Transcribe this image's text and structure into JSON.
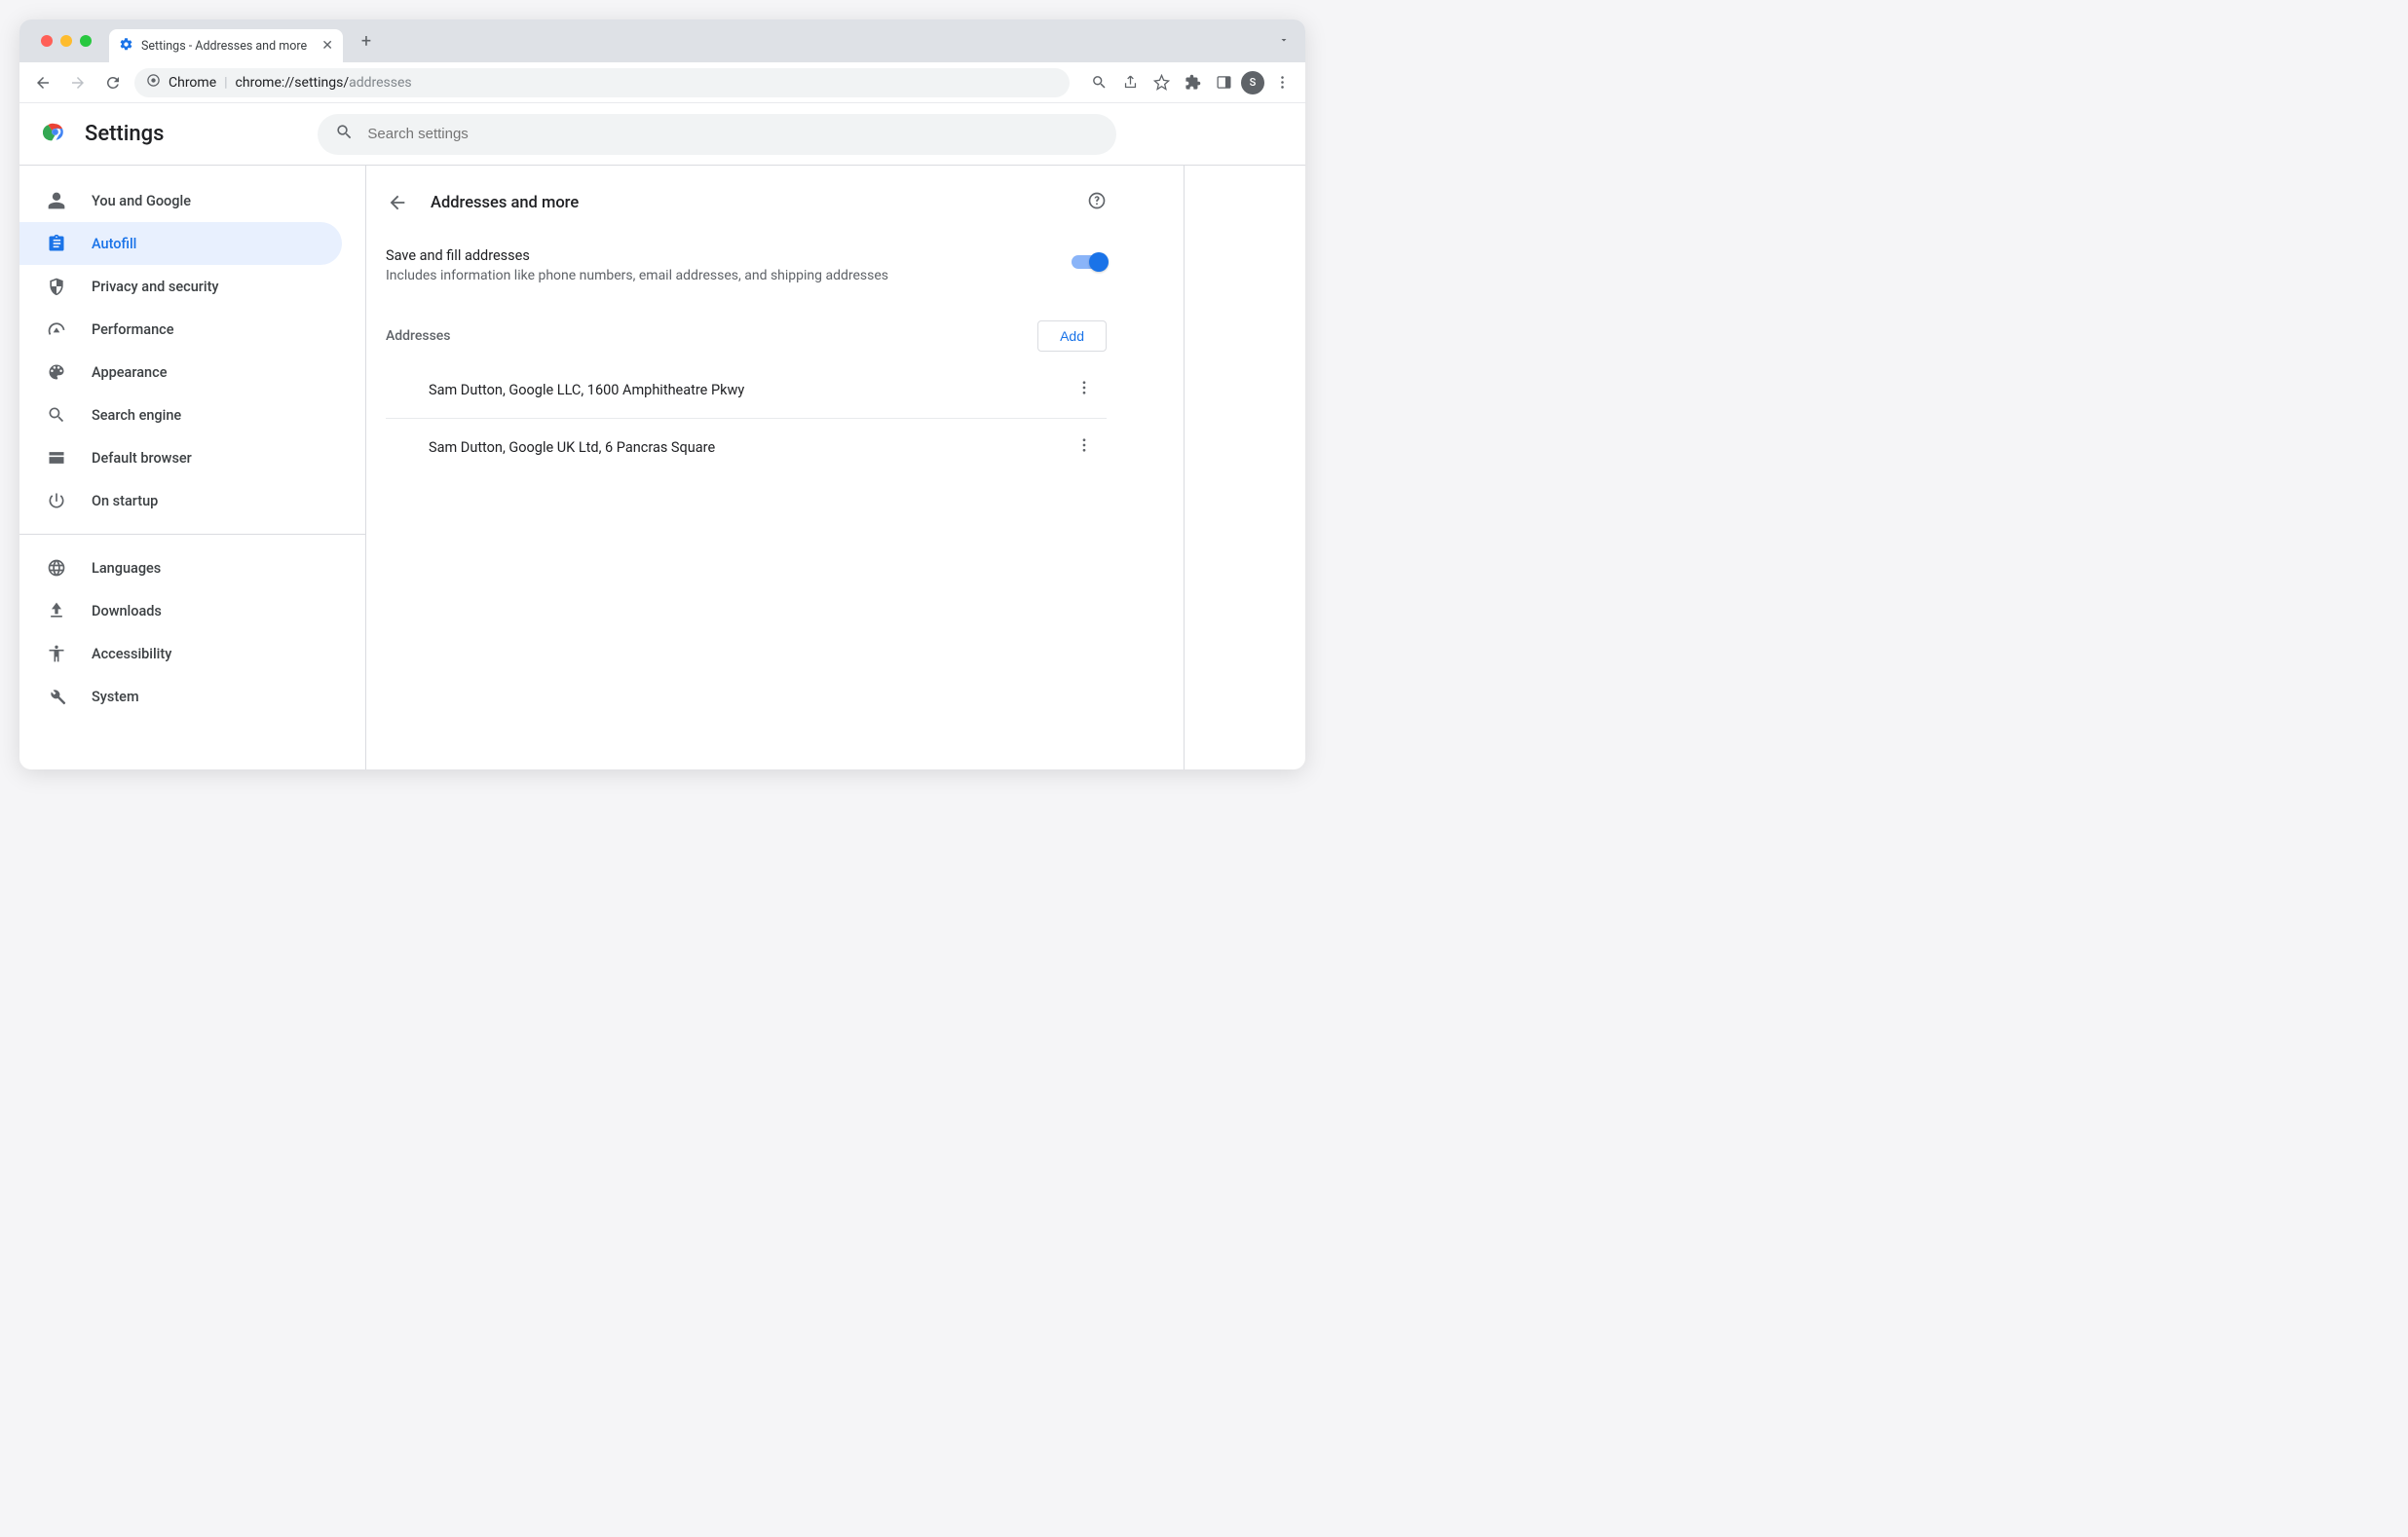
{
  "browser": {
    "tab_title": "Settings - Addresses and more",
    "url_label": "Chrome",
    "url_host": "chrome://",
    "url_path1": "settings/",
    "url_path2": "addresses",
    "avatar_letter": "S"
  },
  "app": {
    "title": "Settings",
    "search_placeholder": "Search settings"
  },
  "sidebar": {
    "items": [
      {
        "label": "You and Google"
      },
      {
        "label": "Autofill"
      },
      {
        "label": "Privacy and security"
      },
      {
        "label": "Performance"
      },
      {
        "label": "Appearance"
      },
      {
        "label": "Search engine"
      },
      {
        "label": "Default browser"
      },
      {
        "label": "On startup"
      },
      {
        "label": "Languages"
      },
      {
        "label": "Downloads"
      },
      {
        "label": "Accessibility"
      },
      {
        "label": "System"
      }
    ]
  },
  "page": {
    "heading": "Addresses and more",
    "toggle_title": "Save and fill addresses",
    "toggle_desc": "Includes information like phone numbers, email addresses, and shipping addresses",
    "section_header": "Addresses",
    "add_label": "Add",
    "addresses": [
      {
        "text": "Sam Dutton, Google LLC, 1600 Amphitheatre Pkwy"
      },
      {
        "text": "Sam Dutton, Google UK Ltd, 6 Pancras Square"
      }
    ]
  }
}
